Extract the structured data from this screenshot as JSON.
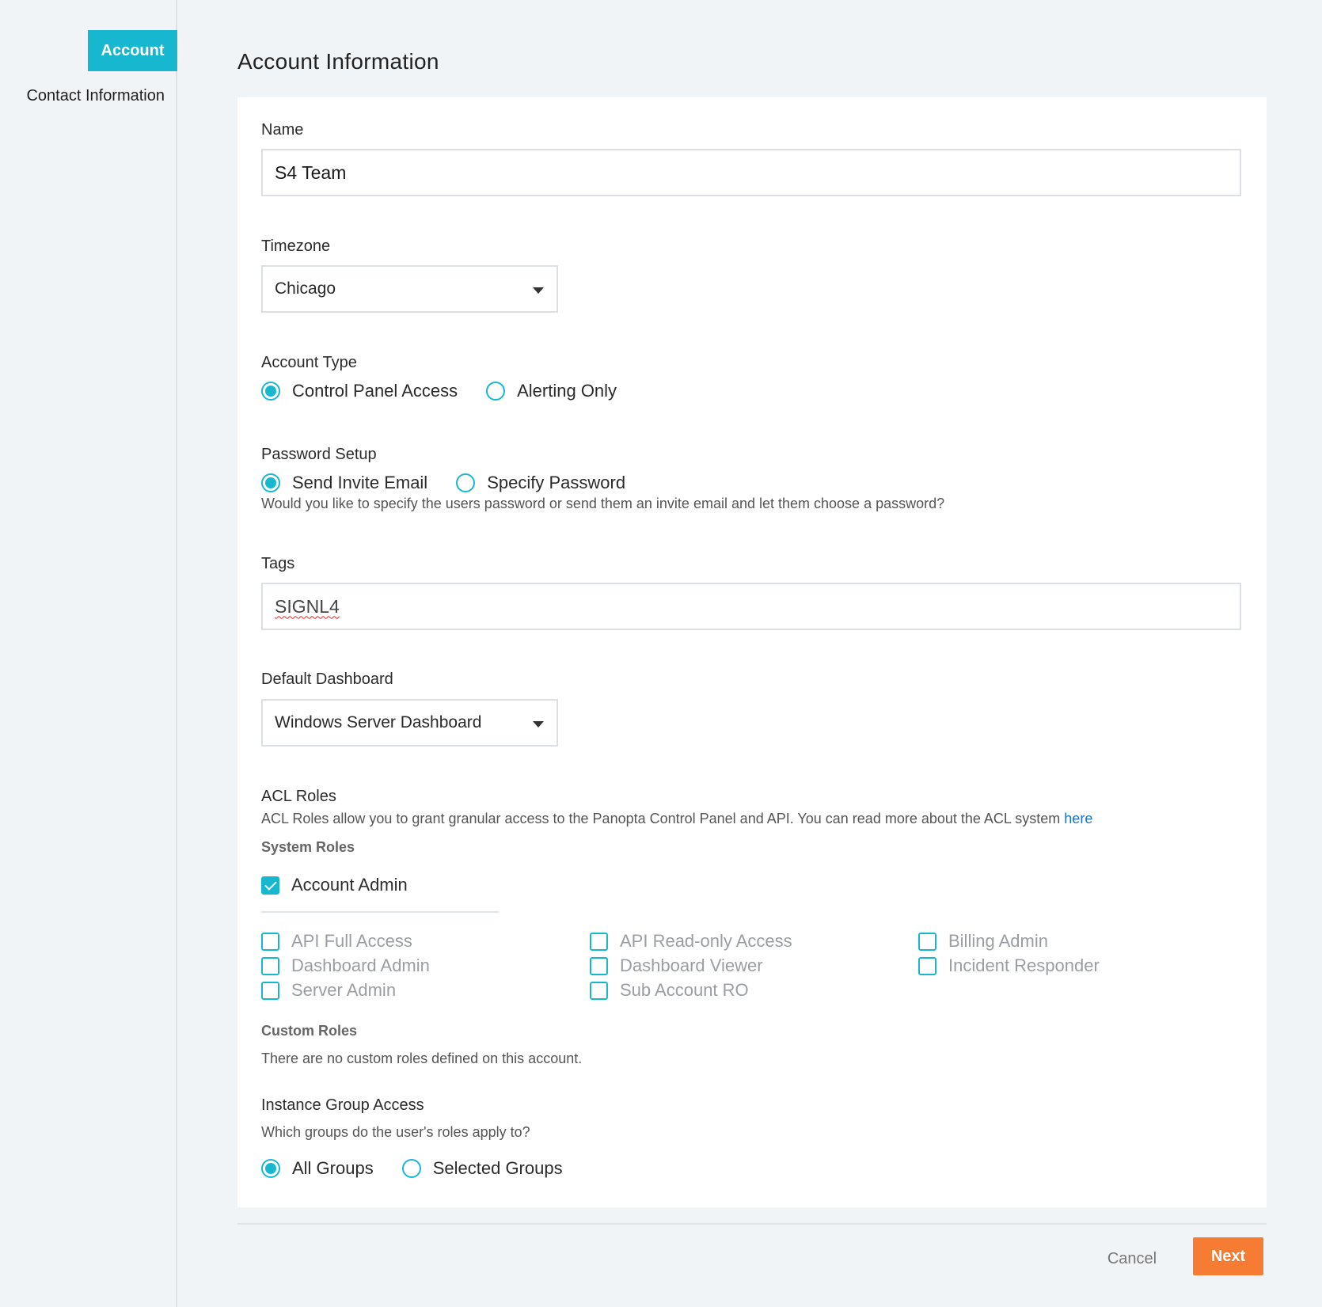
{
  "sidebar": {
    "items": [
      {
        "label": "Account",
        "active": true
      },
      {
        "label": "Contact Information",
        "active": false
      }
    ]
  },
  "page": {
    "title": "Account Information"
  },
  "form": {
    "name": {
      "label": "Name",
      "value": "S4 Team"
    },
    "timezone": {
      "label": "Timezone",
      "value": "Chicago"
    },
    "account_type": {
      "label": "Account Type",
      "options": [
        {
          "label": "Control Panel Access",
          "selected": true
        },
        {
          "label": "Alerting Only",
          "selected": false
        }
      ]
    },
    "password_setup": {
      "label": "Password Setup",
      "options": [
        {
          "label": "Send Invite Email",
          "selected": true
        },
        {
          "label": "Specify Password",
          "selected": false
        }
      ],
      "help": "Would you like to specify the users password or send them an invite email and let them choose a password?"
    },
    "tags": {
      "label": "Tags",
      "value": "SIGNL4"
    },
    "default_dashboard": {
      "label": "Default Dashboard",
      "value": "Windows Server Dashboard"
    },
    "acl_roles": {
      "label": "ACL Roles",
      "help": "ACL Roles allow you to grant granular access to the Panopta Control Panel and API. You can read more about the ACL system",
      "help_link": "here",
      "system_roles_label": "System Roles",
      "account_admin": {
        "label": "Account Admin",
        "checked": true
      },
      "roles": [
        {
          "label": "API Full Access",
          "checked": false
        },
        {
          "label": "API Read-only Access",
          "checked": false
        },
        {
          "label": "Billing Admin",
          "checked": false
        },
        {
          "label": "Dashboard Admin",
          "checked": false
        },
        {
          "label": "Dashboard Viewer",
          "checked": false
        },
        {
          "label": "Incident Responder",
          "checked": false
        },
        {
          "label": "Server Admin",
          "checked": false
        },
        {
          "label": "Sub Account RO",
          "checked": false
        }
      ],
      "custom_roles_label": "Custom Roles",
      "custom_roles_empty": "There are no custom roles defined on this account."
    },
    "instance_group_access": {
      "label": "Instance Group Access",
      "help": "Which groups do the user's roles apply to?",
      "options": [
        {
          "label": "All Groups",
          "selected": true
        },
        {
          "label": "Selected Groups",
          "selected": false
        }
      ]
    }
  },
  "footer": {
    "cancel_label": "Cancel",
    "next_label": "Next"
  },
  "colors": {
    "accent": "#17b8cf",
    "primary_button": "#f57c32",
    "link": "#1b6fd0"
  }
}
